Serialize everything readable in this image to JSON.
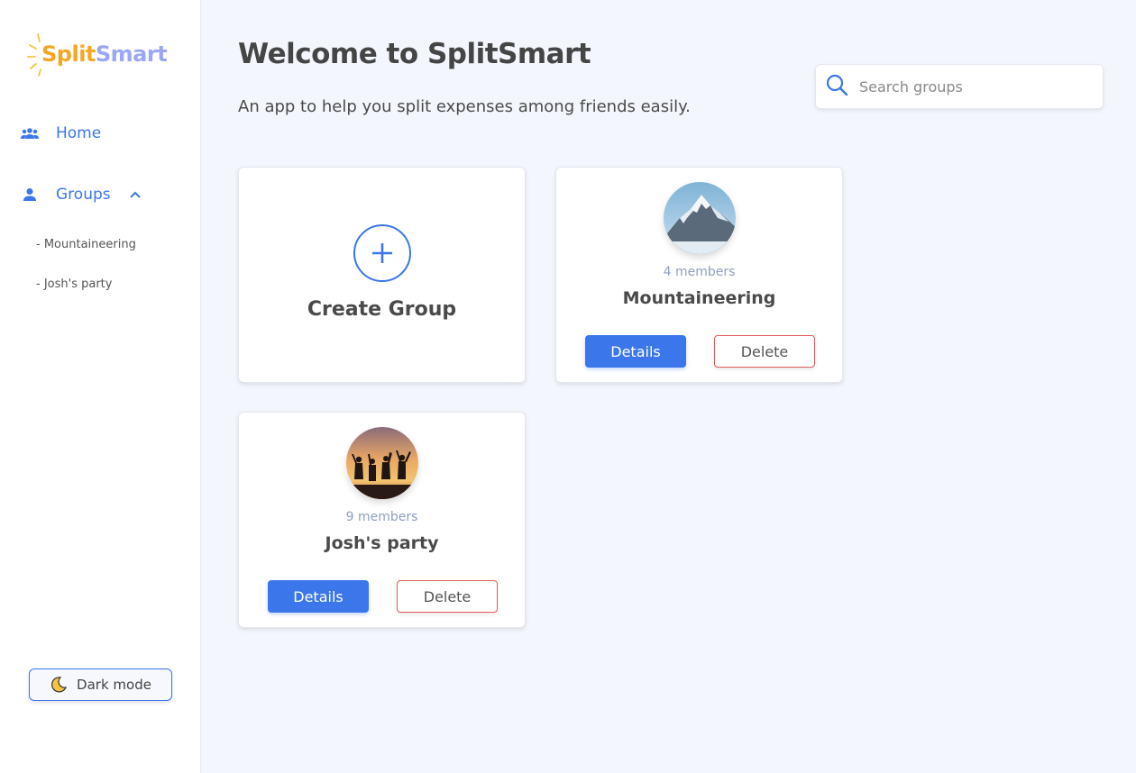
{
  "app": {
    "logo_split": "Split",
    "logo_smart": "Smart",
    "brand_colors": {
      "primary": "#3b76ea",
      "logo_orange": "#f5a623",
      "logo_lavender": "#9aa7f3",
      "danger": "#e25a5a"
    }
  },
  "sidebar": {
    "home_label": "Home",
    "home_icon": "group-icon",
    "groups_label": "Groups",
    "groups_icon": "person-icon",
    "groups_expanded": true,
    "sub_items": [
      {
        "label": "- Mountaineering"
      },
      {
        "label": "- Josh's party"
      }
    ],
    "dark_mode_label": "Dark mode",
    "dark_mode_icon": "moon-icon"
  },
  "header": {
    "title": "Welcome to SplitSmart",
    "subtitle": "An app to help you split expenses among friends easily."
  },
  "search": {
    "placeholder": "Search groups",
    "value": ""
  },
  "create_card": {
    "label": "Create Group",
    "icon": "plus-icon"
  },
  "groups": [
    {
      "name": "Mountaineering",
      "members": "4 members",
      "image": "mountain-photo",
      "details_label": "Details",
      "delete_label": "Delete"
    },
    {
      "name": "Josh's party",
      "members": "9 members",
      "image": "party-sunset-photo",
      "details_label": "Details",
      "delete_label": "Delete"
    }
  ]
}
